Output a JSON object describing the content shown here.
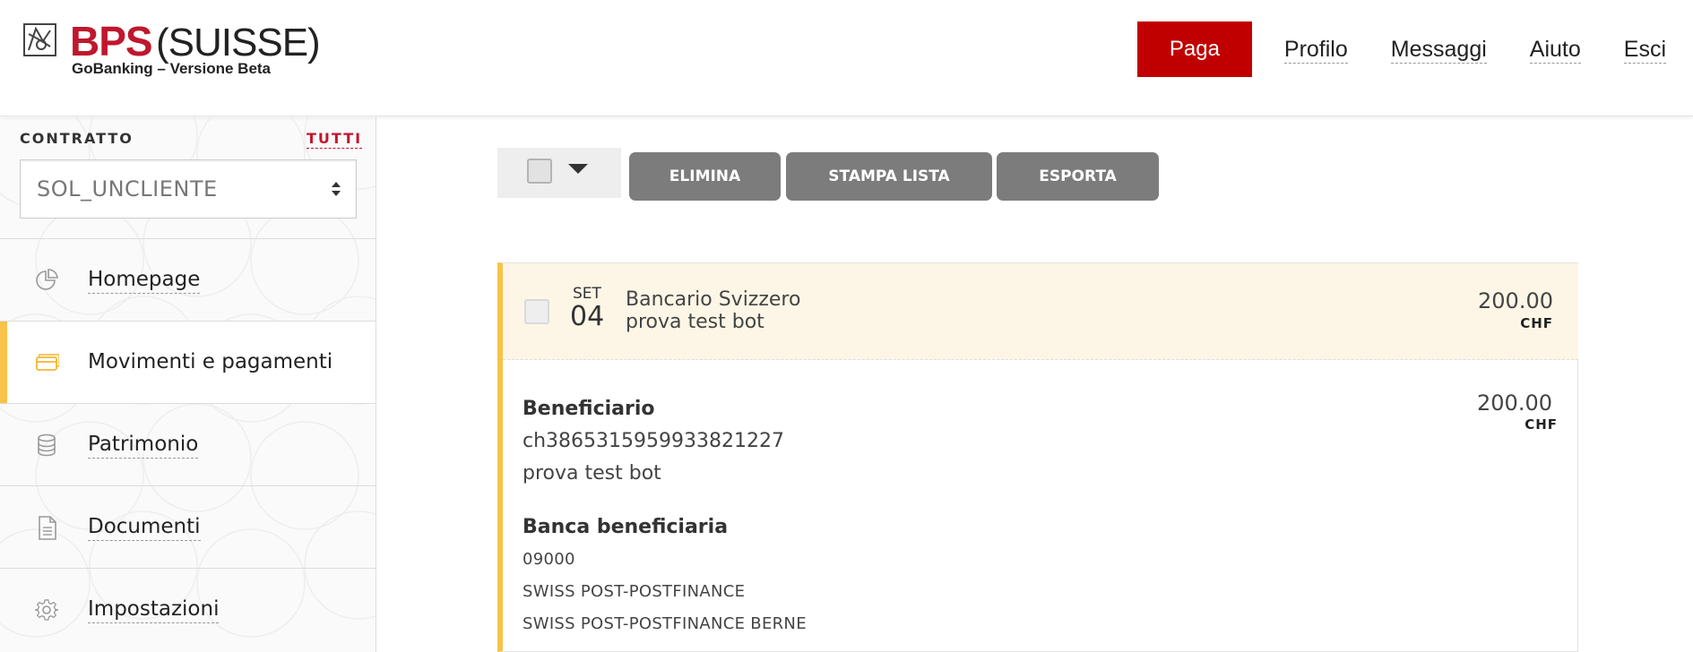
{
  "brand": {
    "name": "BPS",
    "suffix": "(SUISSE)",
    "tagline": "GoBanking – Versione Beta",
    "accent_color": "#c0172d"
  },
  "nav": {
    "pay_label": "Paga",
    "links": [
      "Profilo",
      "Messaggi",
      "Aiuto",
      "Esci"
    ]
  },
  "sidebar": {
    "contract_label": "CONTRATTO",
    "all_label": "TUTTI",
    "contract_value": "SOL_UNCLIENTE",
    "items": [
      {
        "label": "Homepage",
        "icon": "pie-chart-icon"
      },
      {
        "label": "Movimenti e pagamenti",
        "icon": "credit-card-icon",
        "active": true
      },
      {
        "label": "Patrimonio",
        "icon": "coins-stack-icon"
      },
      {
        "label": "Documenti",
        "icon": "document-icon"
      },
      {
        "label": "Impostazioni",
        "icon": "gear-icon"
      }
    ],
    "active_color": "#f7c348"
  },
  "toolbar": {
    "delete_label": "ELIMINA",
    "print_label": "STAMPA LISTA",
    "export_label": "ESPORTA"
  },
  "transaction": {
    "month": "SET",
    "day": "04",
    "title": "Bancario Svizzero",
    "subtitle": "prova test bot",
    "amount": "200.00",
    "currency": "CHF",
    "detail": {
      "beneficiary_label": "Beneficiario",
      "iban": "ch3865315959933821227",
      "beneficiary_name": "prova test bot",
      "amount": "200.00",
      "currency": "CHF",
      "bank_label": "Banca beneficiaria",
      "bank_code": "09000",
      "bank_name": "SWISS POST-POSTFINANCE",
      "bank_city": "SWISS POST-POSTFINANCE BERNE"
    }
  }
}
